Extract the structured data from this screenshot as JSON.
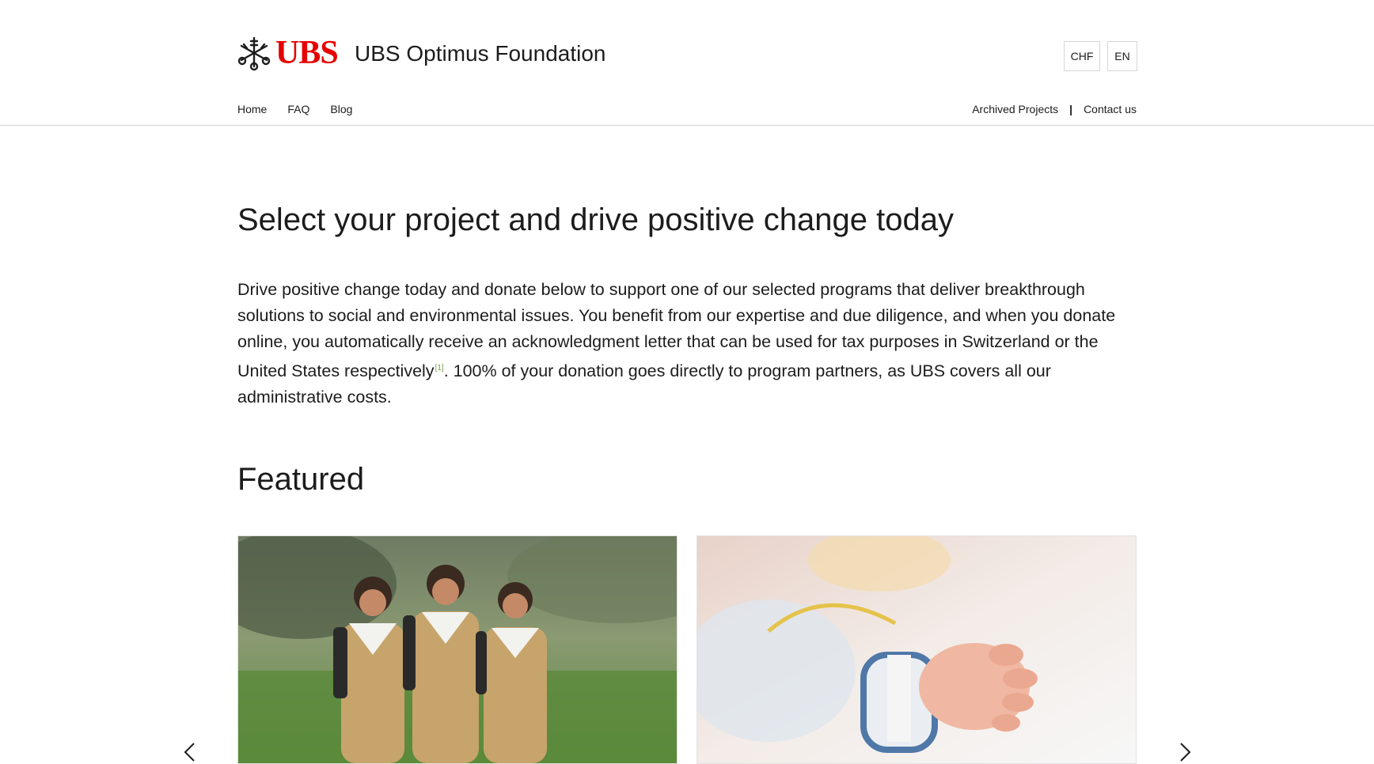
{
  "brand": {
    "wordmark": "UBS",
    "title": "UBS Optimus Foundation",
    "logo_icon": "ubs-keys-icon",
    "brand_color": "#e60000"
  },
  "header": {
    "currency": "CHF",
    "language": "EN"
  },
  "nav": {
    "left": [
      "Home",
      "FAQ",
      "Blog"
    ],
    "right": [
      "Archived Projects",
      "Contact us"
    ],
    "separator": "|"
  },
  "main": {
    "headline": "Select your project and drive positive change today",
    "intro_part1": "Drive positive change today and donate below to support one of our selected programs that deliver breakthrough solutions to social and environmental issues. You benefit from our expertise and due diligence, and when you donate online, you automatically receive an acknowledgment letter that can be used for tax purposes in Switzerland or the United States respectively",
    "footnote_marker": "[1]",
    "intro_part2": ". 100% of your donation goes directly to program partners, as UBS covers all our administrative costs.",
    "featured_heading": "Featured"
  },
  "carousel": {
    "prev_icon": "chevron-left-icon",
    "next_icon": "chevron-right-icon"
  }
}
